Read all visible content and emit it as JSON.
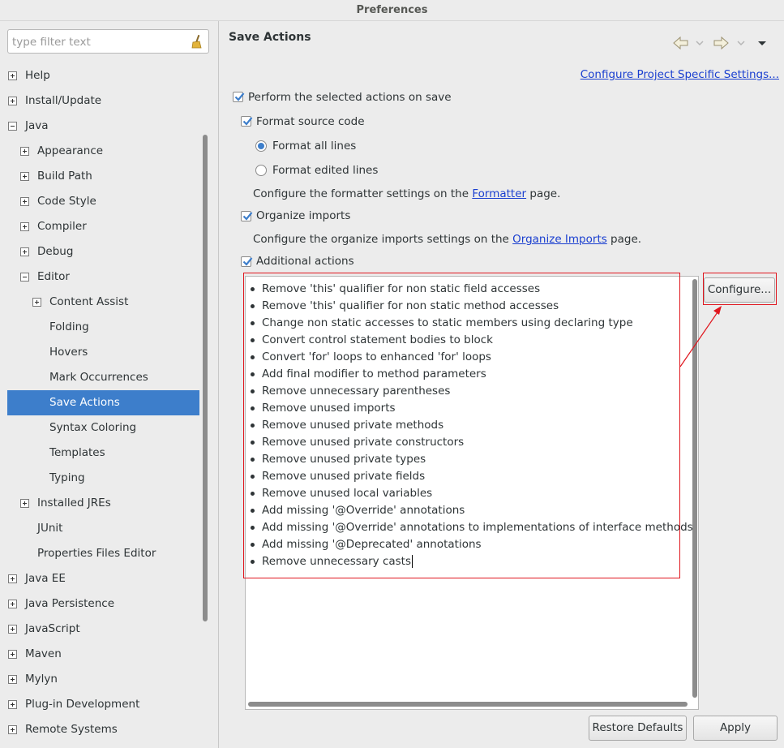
{
  "window": {
    "title": "Preferences"
  },
  "filter": {
    "placeholder": "type filter text"
  },
  "tree": [
    {
      "label": "Help",
      "level": 0,
      "expander": "plus"
    },
    {
      "label": "Install/Update",
      "level": 0,
      "expander": "plus"
    },
    {
      "label": "Java",
      "level": 0,
      "expander": "minus"
    },
    {
      "label": "Appearance",
      "level": 1,
      "expander": "plus"
    },
    {
      "label": "Build Path",
      "level": 1,
      "expander": "plus"
    },
    {
      "label": "Code Style",
      "level": 1,
      "expander": "plus"
    },
    {
      "label": "Compiler",
      "level": 1,
      "expander": "plus"
    },
    {
      "label": "Debug",
      "level": 1,
      "expander": "plus"
    },
    {
      "label": "Editor",
      "level": 1,
      "expander": "minus"
    },
    {
      "label": "Content Assist",
      "level": 2,
      "expander": "plus"
    },
    {
      "label": "Folding",
      "level": 2,
      "expander": "none"
    },
    {
      "label": "Hovers",
      "level": 2,
      "expander": "none"
    },
    {
      "label": "Mark Occurrences",
      "level": 2,
      "expander": "none"
    },
    {
      "label": "Save Actions",
      "level": 2,
      "expander": "none",
      "selected": true
    },
    {
      "label": "Syntax Coloring",
      "level": 2,
      "expander": "none"
    },
    {
      "label": "Templates",
      "level": 2,
      "expander": "none"
    },
    {
      "label": "Typing",
      "level": 2,
      "expander": "none"
    },
    {
      "label": "Installed JREs",
      "level": 1,
      "expander": "plus"
    },
    {
      "label": "JUnit",
      "level": 1,
      "expander": "none"
    },
    {
      "label": "Properties Files Editor",
      "level": 1,
      "expander": "none"
    },
    {
      "label": "Java EE",
      "level": 0,
      "expander": "plus"
    },
    {
      "label": "Java Persistence",
      "level": 0,
      "expander": "plus"
    },
    {
      "label": "JavaScript",
      "level": 0,
      "expander": "plus"
    },
    {
      "label": "Maven",
      "level": 0,
      "expander": "plus"
    },
    {
      "label": "Mylyn",
      "level": 0,
      "expander": "plus"
    },
    {
      "label": "Plug-in Development",
      "level": 0,
      "expander": "plus"
    },
    {
      "label": "Remote Systems",
      "level": 0,
      "expander": "plus"
    }
  ],
  "page": {
    "title": "Save Actions",
    "configure_project_link": "Configure Project Specific Settings...",
    "perform_on_save": {
      "label": "Perform the selected actions on save",
      "checked": true
    },
    "format_source": {
      "label": "Format source code",
      "checked": true
    },
    "format_all_lines": {
      "label": "Format all lines",
      "selected": true
    },
    "format_edited_lines": {
      "label": "Format edited lines",
      "selected": false
    },
    "formatter_hint": {
      "before": "Configure the formatter settings on the ",
      "link": "Formatter",
      "after": " page."
    },
    "organize_imports": {
      "label": "Organize imports",
      "checked": true
    },
    "organize_hint": {
      "before": "Configure the organize imports settings on the ",
      "link": "Organize Imports",
      "after": " page."
    },
    "additional_actions": {
      "label": "Additional actions",
      "checked": true
    },
    "actions": [
      "Remove 'this' qualifier for non static field accesses",
      "Remove 'this' qualifier for non static method accesses",
      "Change non static accesses to static members using declaring type",
      "Convert control statement bodies to block",
      "Convert 'for' loops to enhanced 'for' loops",
      "Add final modifier to method parameters",
      "Remove unnecessary parentheses",
      "Remove unused imports",
      "Remove unused private methods",
      "Remove unused private constructors",
      "Remove unused private types",
      "Remove unused private fields",
      "Remove unused local variables",
      "Add missing '@Override' annotations",
      "Add missing '@Override' annotations to implementations of interface methods",
      "Add missing '@Deprecated' annotations",
      "Remove unnecessary casts"
    ],
    "configure_button": "Configure...",
    "restore_defaults_button": "Restore Defaults",
    "apply_button": "Apply"
  },
  "colors": {
    "selection": "#3d7ecb",
    "link": "#1a3fd0",
    "annotation": "#e0161e"
  }
}
